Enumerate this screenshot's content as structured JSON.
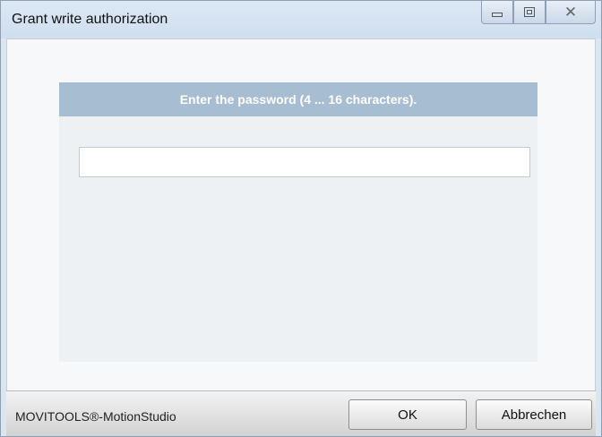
{
  "window": {
    "title": "Grant write authorization"
  },
  "panel": {
    "header": "Enter the password (4 ... 16 characters).",
    "password_value": ""
  },
  "footer": {
    "app_label": "MOVITOOLS®-MotionStudio",
    "ok_label": "OK",
    "cancel_label": "Abbrechen"
  },
  "icons": {
    "minimize": "minimize-icon",
    "maximize": "maximize-icon",
    "close": "close-icon"
  }
}
